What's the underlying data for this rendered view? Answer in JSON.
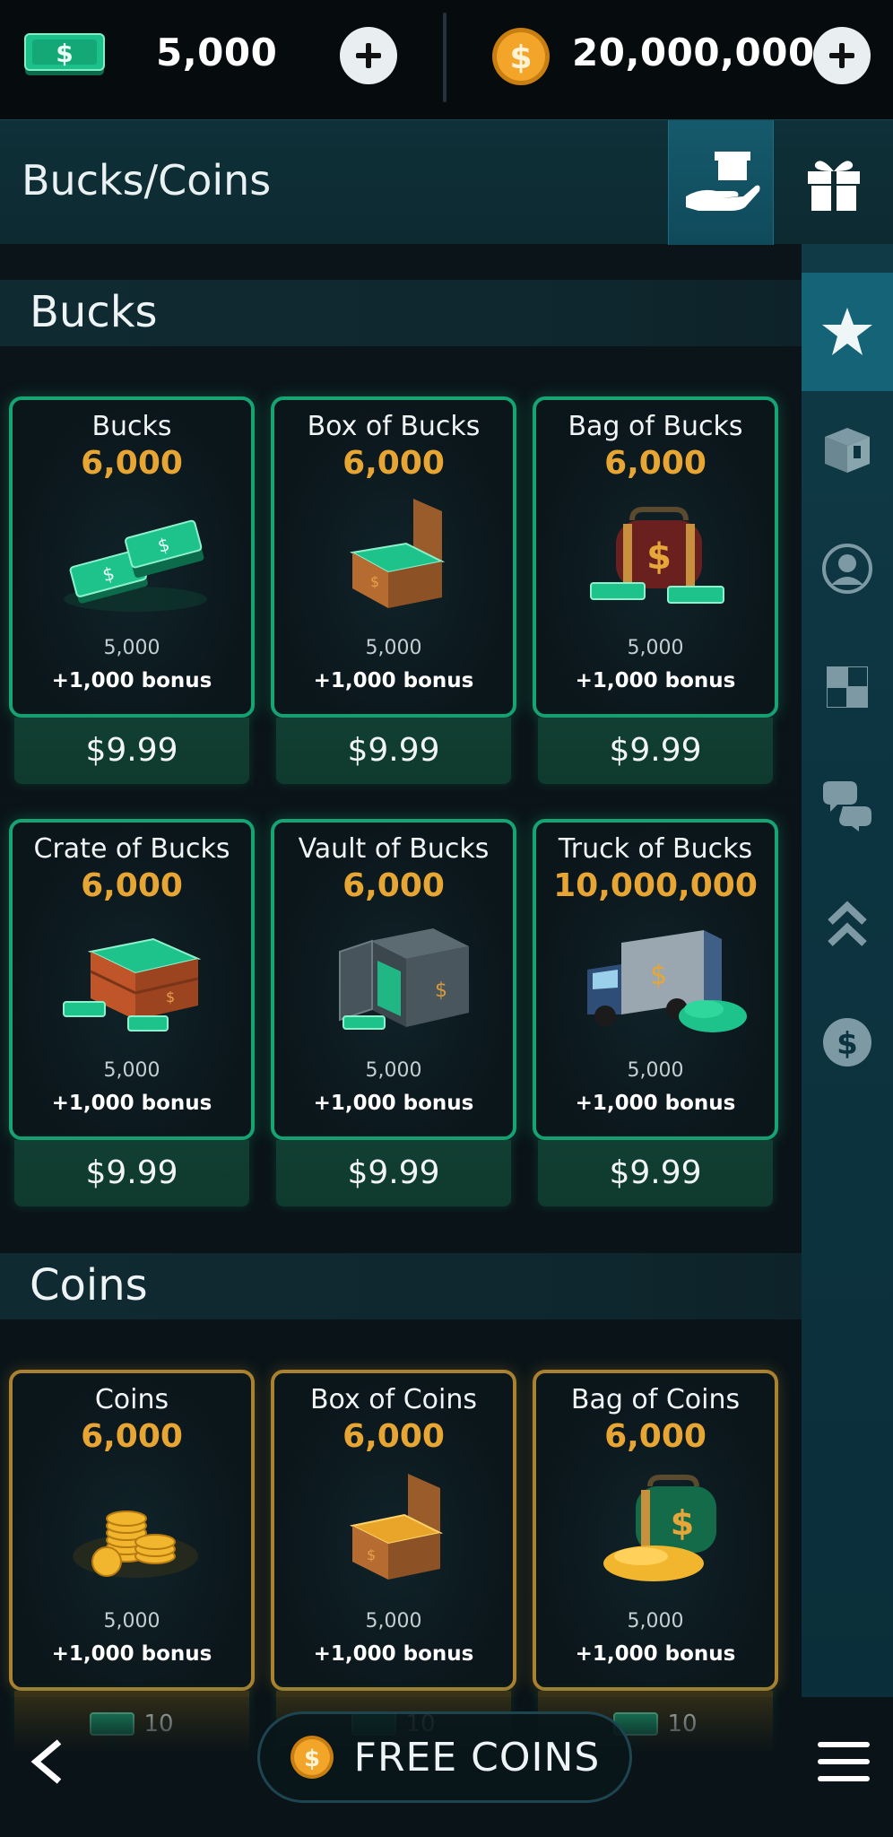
{
  "topbar": {
    "bucks": {
      "icon": "bucks-bill-icon",
      "value": "5,000"
    },
    "coins": {
      "icon": "coin-icon",
      "value": "20,000,000"
    }
  },
  "header": {
    "title": "Bucks/Coins"
  },
  "sidebar": {
    "items": [
      {
        "icon": "star-icon",
        "active": true
      },
      {
        "icon": "box-icon"
      },
      {
        "icon": "avatar-icon"
      },
      {
        "icon": "checker-tile-icon"
      },
      {
        "icon": "chat-bubbles-icon"
      },
      {
        "icon": "double-chevron-up-icon"
      },
      {
        "icon": "dollar-coin-icon"
      }
    ]
  },
  "sections": {
    "bucks": {
      "title": "Bucks",
      "items": [
        {
          "name": "Bucks",
          "amount": "6,000",
          "base": "5,000",
          "bonus": "+1,000 bonus",
          "price": "$9.99"
        },
        {
          "name": "Box of Bucks",
          "amount": "6,000",
          "base": "5,000",
          "bonus": "+1,000 bonus",
          "price": "$9.99"
        },
        {
          "name": "Bag of Bucks",
          "amount": "6,000",
          "base": "5,000",
          "bonus": "+1,000 bonus",
          "price": "$9.99"
        },
        {
          "name": "Crate of Bucks",
          "amount": "6,000",
          "base": "5,000",
          "bonus": "+1,000 bonus",
          "price": "$9.99"
        },
        {
          "name": "Vault of Bucks",
          "amount": "6,000",
          "base": "5,000",
          "bonus": "+1,000 bonus",
          "price": "$9.99"
        },
        {
          "name": "Truck of Bucks",
          "amount": "10,000,000",
          "base": "5,000",
          "bonus": "+1,000 bonus",
          "price": "$9.99"
        }
      ]
    },
    "coins": {
      "title": "Coins",
      "items": [
        {
          "name": "Coins",
          "amount": "6,000",
          "base": "5,000",
          "bonus": "+1,000 bonus",
          "price": "10"
        },
        {
          "name": "Box of Coins",
          "amount": "6,000",
          "base": "5,000",
          "bonus": "+1,000 bonus",
          "price": "10"
        },
        {
          "name": "Bag of Coins",
          "amount": "6,000",
          "base": "5,000",
          "bonus": "+1,000 bonus",
          "price": "10"
        }
      ]
    }
  },
  "bottombar": {
    "free_coins_label": "FREE COINS"
  },
  "colors": {
    "accent_green": "#17a473",
    "accent_gold": "#e7a533",
    "gold_border": "#a9812f",
    "panel": "#0f3038"
  }
}
